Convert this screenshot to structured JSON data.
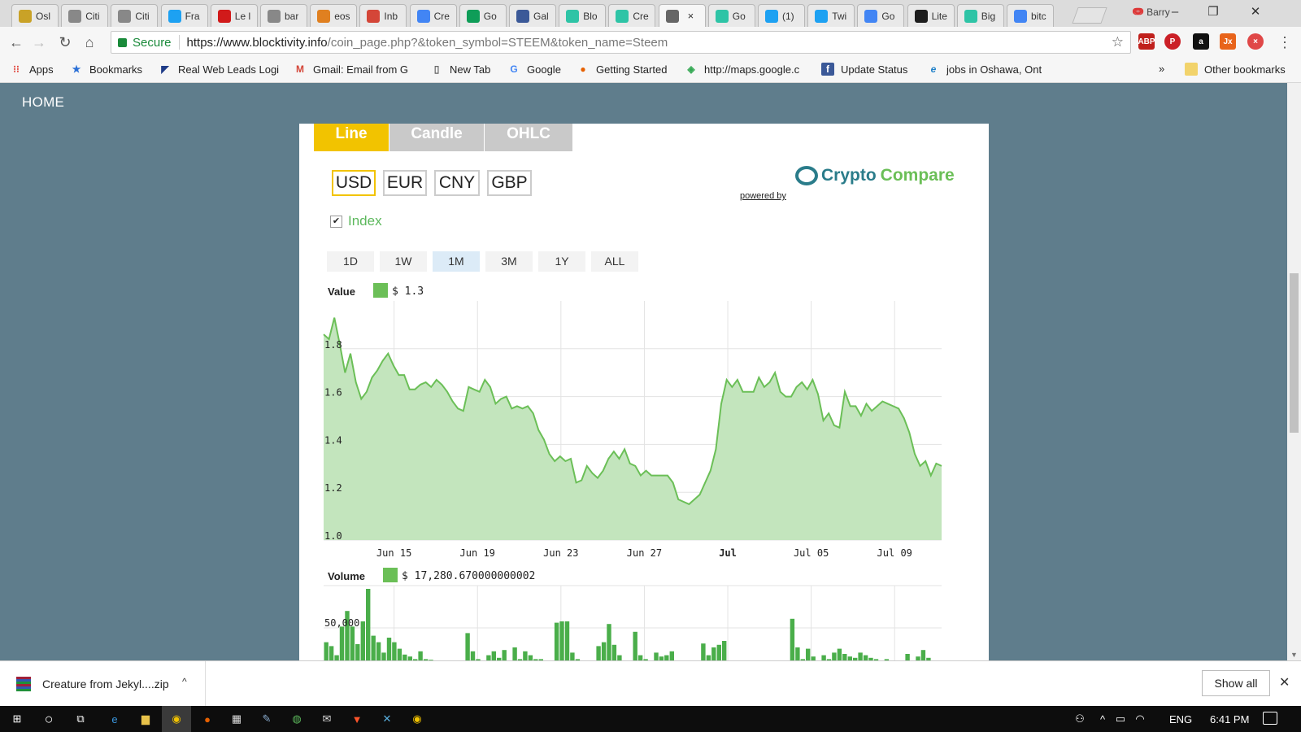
{
  "browser": {
    "tabs": [
      {
        "label": "Osl",
        "icon": "coin-icon",
        "color": "#c9a227"
      },
      {
        "label": "Citi",
        "icon": "page-icon",
        "color": "#888888"
      },
      {
        "label": "Citi",
        "icon": "page-icon",
        "color": "#888888"
      },
      {
        "label": "Fra",
        "icon": "twitter-icon",
        "color": "#1da1f2"
      },
      {
        "label": "Le l",
        "icon": "la-icon",
        "color": "#d11a1a"
      },
      {
        "label": "bar",
        "icon": "page-icon",
        "color": "#888888"
      },
      {
        "label": "eos",
        "icon": "chart-icon",
        "color": "#e08020"
      },
      {
        "label": "Inb",
        "icon": "gmail-icon",
        "color": "#d44638"
      },
      {
        "label": "Cre",
        "icon": "docs-icon",
        "color": "#4285f4"
      },
      {
        "label": "Go",
        "icon": "drive-icon",
        "color": "#0f9d58"
      },
      {
        "label": "Gal",
        "icon": "facebook-icon",
        "color": "#3b5998"
      },
      {
        "label": "Blo",
        "icon": "blocktivity-icon",
        "color": "#2ec4a6"
      },
      {
        "label": "Cre",
        "icon": "blocktivity-icon",
        "color": "#2ec4a6"
      },
      {
        "label": "",
        "icon": "loading-icon",
        "color": "#666666",
        "active": true
      },
      {
        "label": "Go",
        "icon": "blocktivity-icon",
        "color": "#2ec4a6"
      },
      {
        "label": "(1)",
        "icon": "twitter-icon",
        "color": "#1da1f2"
      },
      {
        "label": "Twi",
        "icon": "twitter-icon",
        "color": "#1da1f2"
      },
      {
        "label": "Go",
        "icon": "google-icon",
        "color": "#4285f4"
      },
      {
        "label": "Lite",
        "icon": "binance-icon",
        "color": "#1e1e1e"
      },
      {
        "label": "Big",
        "icon": "blocktivity-icon",
        "color": "#2ec4a6"
      },
      {
        "label": "bitc",
        "icon": "google-icon",
        "color": "#4285f4"
      }
    ],
    "profile_name": "Barry",
    "url_secure_label": "Secure",
    "url_host": "https://www.blocktivity.info",
    "url_path": "/coin_page.php?&token_symbol=STEEM&token_name=Steem",
    "bookmarks": [
      {
        "label": "Apps",
        "icon": "apps-icon"
      },
      {
        "label": "Bookmarks",
        "icon": "star-icon"
      },
      {
        "label": "Real Web Leads Logi",
        "icon": "rwl-icon"
      },
      {
        "label": "Gmail: Email from G",
        "icon": "gmail-icon"
      },
      {
        "label": "New Tab",
        "icon": "page-icon"
      },
      {
        "label": "Google",
        "icon": "google-icon"
      },
      {
        "label": "Getting Started",
        "icon": "firefox-icon"
      },
      {
        "label": "http://maps.google.c",
        "icon": "maps-icon"
      },
      {
        "label": "Update Status",
        "icon": "facebook-icon"
      },
      {
        "label": "jobs in Oshawa, Ont",
        "icon": "ie-icon"
      }
    ],
    "bookmarks_overflow": "»",
    "other_bookmarks": "Other bookmarks"
  },
  "site": {
    "home": "HOME"
  },
  "chart_controls": {
    "chart_types": [
      "Line",
      "Candle",
      "OHLC"
    ],
    "selected_type": "Line",
    "currencies": [
      "USD",
      "EUR",
      "CNY",
      "GBP"
    ],
    "selected_currency": "USD",
    "powered_by": "powered by",
    "logo_text_1": "Crypto",
    "logo_text_2": "Compare",
    "index_label": "Index",
    "index_checked": true,
    "ranges": [
      "1D",
      "1W",
      "1M",
      "3M",
      "1Y",
      "ALL"
    ],
    "selected_range": "1M",
    "value_legend_title": "Value",
    "value_legend_value": "$ 1.3",
    "volume_legend_title": "Volume",
    "volume_legend_value": "$ 17,280.670000000002"
  },
  "chart_data": [
    {
      "type": "area",
      "series": [
        {
          "name": "Value",
          "color": "#6bbf57",
          "fill": "#c3e5bd",
          "values": [
            1.86,
            1.84,
            1.93,
            1.82,
            1.7,
            1.78,
            1.66,
            1.59,
            1.62,
            1.68,
            1.71,
            1.75,
            1.78,
            1.73,
            1.69,
            1.69,
            1.63,
            1.63,
            1.65,
            1.66,
            1.64,
            1.67,
            1.65,
            1.62,
            1.58,
            1.55,
            1.54,
            1.64,
            1.63,
            1.62,
            1.67,
            1.64,
            1.57,
            1.59,
            1.6,
            1.55,
            1.56,
            1.55,
            1.56,
            1.53,
            1.46,
            1.42,
            1.36,
            1.33,
            1.35,
            1.33,
            1.34,
            1.24,
            1.25,
            1.31,
            1.28,
            1.26,
            1.29,
            1.34,
            1.37,
            1.34,
            1.38,
            1.32,
            1.31,
            1.27,
            1.29,
            1.27,
            1.27,
            1.27,
            1.27,
            1.24,
            1.17,
            1.16,
            1.15,
            1.17,
            1.19,
            1.24,
            1.29,
            1.38,
            1.57,
            1.67,
            1.64,
            1.67,
            1.62,
            1.62,
            1.62,
            1.68,
            1.64,
            1.66,
            1.7,
            1.62,
            1.6,
            1.6,
            1.64,
            1.66,
            1.63,
            1.67,
            1.61,
            1.5,
            1.53,
            1.48,
            1.47,
            1.62,
            1.56,
            1.56,
            1.52,
            1.57,
            1.54,
            1.56,
            1.58,
            1.57,
            1.56,
            1.55,
            1.51,
            1.45,
            1.36,
            1.31,
            1.33,
            1.27,
            1.32,
            1.31
          ]
        }
      ],
      "x_ticks": [
        "Jun 15",
        "Jun 19",
        "Jun 23",
        "Jun 27",
        "Jul",
        "Jul 05",
        "Jul 09"
      ],
      "y_ticks": [
        "1.0",
        "1.2",
        "1.4",
        "1.6",
        "1.8"
      ],
      "ylim": [
        1.0,
        2.0
      ],
      "grid": true
    },
    {
      "type": "bar",
      "series": [
        {
          "name": "Volume",
          "color": "#4aae4a",
          "values": [
            28000,
            22000,
            8000,
            52000,
            76000,
            52000,
            25000,
            60000,
            110000,
            38000,
            28000,
            12000,
            35000,
            28000,
            18000,
            9000,
            6000,
            2000,
            14000,
            2000,
            1000,
            0,
            0,
            0,
            0,
            0,
            0,
            42000,
            14000,
            2000,
            0,
            8000,
            14000,
            4000,
            16000,
            0,
            20000,
            2000,
            14000,
            8000,
            2000,
            2000,
            0,
            0,
            58000,
            60000,
            60000,
            12000,
            2000,
            0,
            0,
            0,
            22000,
            28000,
            56000,
            24000,
            8000,
            0,
            0,
            44000,
            8000,
            2000,
            0,
            12000,
            6000,
            8000,
            14000,
            0,
            0,
            0,
            0,
            0,
            26000,
            8000,
            20000,
            24000,
            30000,
            0,
            0,
            0,
            0,
            0,
            0,
            0,
            0,
            0,
            0,
            0,
            0,
            64000,
            20000,
            2000,
            18000,
            6000,
            0,
            8000,
            2000,
            12000,
            18000,
            10000,
            6000,
            4000,
            12000,
            8000,
            4000,
            2000,
            0,
            2000,
            0,
            0,
            0,
            10000,
            0,
            6000,
            16000,
            4000,
            0,
            0
          ]
        }
      ],
      "y_ticks": [
        "50,000"
      ],
      "ylim": [
        0,
        115000
      ],
      "grid": true
    }
  ],
  "download": {
    "filename": "Creature from Jekyl....zip",
    "show_all": "Show all"
  },
  "taskbar": {
    "lang": "ENG",
    "time": "6:41 PM"
  }
}
